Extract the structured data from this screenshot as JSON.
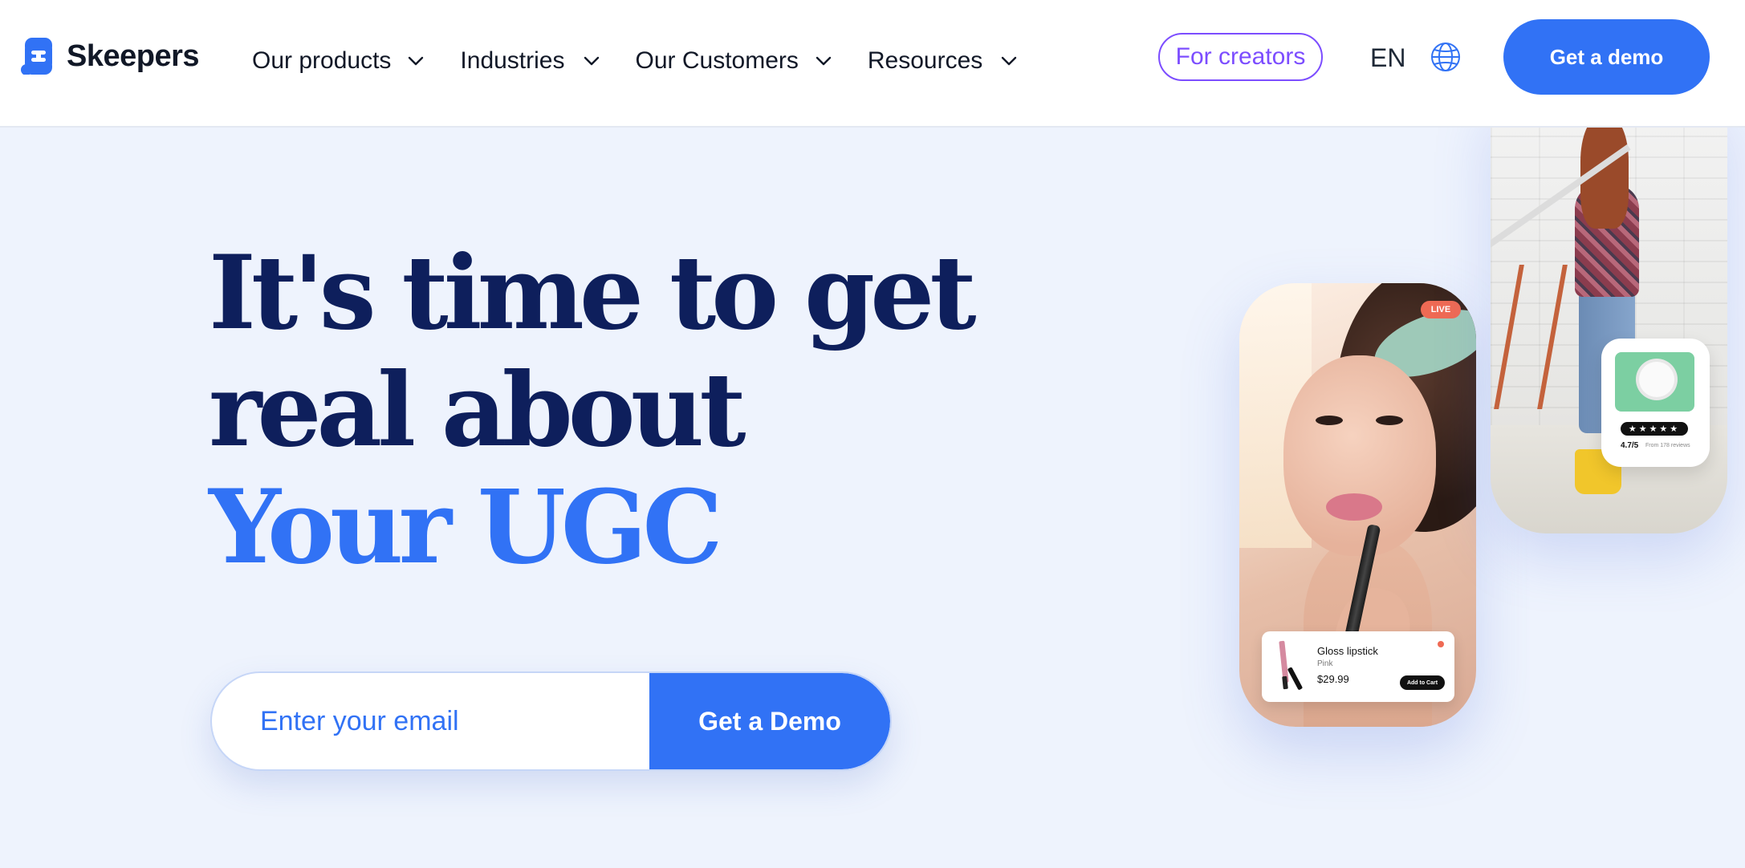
{
  "header": {
    "logo_text": "Skeepers",
    "nav": [
      {
        "label": "Our products"
      },
      {
        "label": "Industries"
      },
      {
        "label": "Our Customers"
      },
      {
        "label": "Resources"
      }
    ],
    "for_creators": "For creators",
    "language": "EN",
    "demo_label": "Get a demo"
  },
  "hero": {
    "line1": "It's time to get",
    "line2": "real about",
    "line3": "Your UGC",
    "email_placeholder": "Enter your email",
    "submit_label": "Get a Demo"
  },
  "live_card": {
    "live_badge": "LIVE",
    "product_name": "Gloss lipstick",
    "product_variant": "Pink",
    "product_price": "$29.99",
    "add_to_cart": "Add to Cart"
  },
  "review_card": {
    "stars": "★★★★★",
    "rating": "4.7/5",
    "reviews": "From 178 reviews"
  },
  "colors": {
    "brand_blue": "#3172f5",
    "navy": "#0e1f5c",
    "creators_purple": "#7c4dff",
    "hero_bg": "#eef3fd"
  },
  "icons": {
    "logo": "skeepers-logo-icon",
    "chevron": "chevron-down-icon",
    "globe": "globe-icon"
  }
}
